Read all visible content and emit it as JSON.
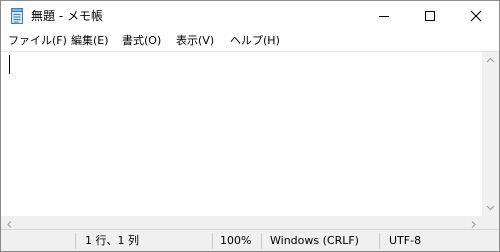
{
  "window": {
    "title": "無題 - メモ帳",
    "app_icon": "notepad-icon",
    "buttons": {
      "minimize_icon": "minimize-icon",
      "maximize_icon": "maximize-icon",
      "close_icon": "close-icon"
    }
  },
  "menu": {
    "items": [
      {
        "label": "ファイル(F)"
      },
      {
        "label": "編集(E)"
      },
      {
        "label": "書式(O)"
      },
      {
        "label": "表示(V)"
      },
      {
        "label": "ヘルプ(H)"
      }
    ]
  },
  "editor": {
    "content": ""
  },
  "status": {
    "position": "1 行、1 列",
    "zoom": "100%",
    "line_ending": "Windows (CRLF)",
    "encoding": "UTF-8"
  },
  "colors": {
    "window_bg": "#ffffff",
    "statusbar_bg": "#f0f0f0",
    "scrollbar_bg": "#f0f0f0"
  }
}
